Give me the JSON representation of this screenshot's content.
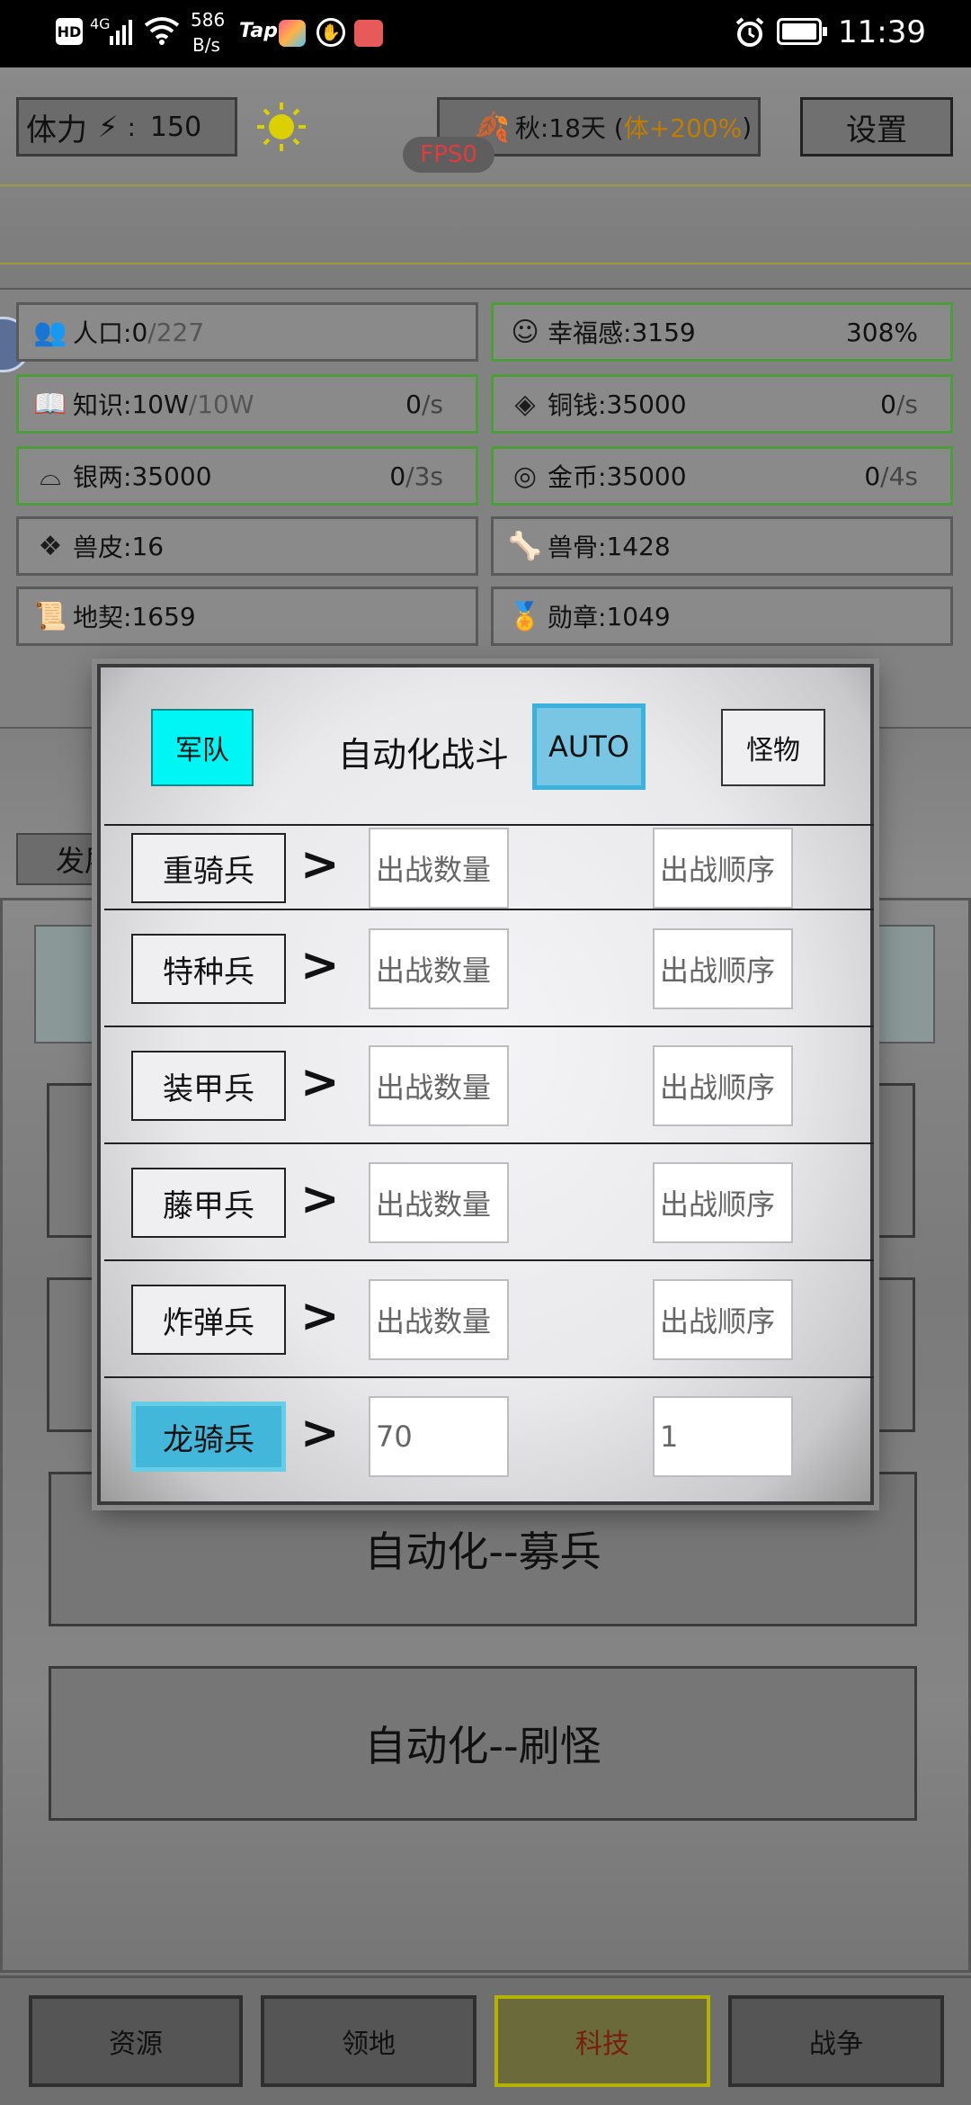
{
  "status_bar": {
    "hd": "HD",
    "network": "4G",
    "speed_value": "586",
    "speed_unit": "B/s",
    "tap": "Tap",
    "time": "11:39"
  },
  "hud": {
    "stamina_label": "体力",
    "stamina_sep": ":",
    "stamina_value": "150",
    "season_text": "秋:18天 (",
    "season_bonus": "体+200%",
    "season_close": ")",
    "settings_label": "设置",
    "fps": "FPS0"
  },
  "resources": [
    {
      "icon": "people-icon",
      "label": "人口:",
      "value": "0",
      "value_extra": "/227",
      "rate": "",
      "unit": "",
      "right": "",
      "highlight": false
    },
    {
      "icon": "smile-icon",
      "label": "幸福感:",
      "value": "3159",
      "value_extra": "",
      "rate": "",
      "unit": "",
      "right": "308%",
      "highlight": true
    },
    {
      "icon": "book-icon",
      "label": "知识:",
      "value": "10W",
      "value_extra": "/10W",
      "rate": "0",
      "unit": "/s",
      "right": "",
      "highlight": true
    },
    {
      "icon": "coin-icon",
      "label": "铜钱:",
      "value": "35000",
      "value_extra": "",
      "rate": "0",
      "unit": "/s",
      "right": "",
      "highlight": true
    },
    {
      "icon": "ingot-icon",
      "label": "银两:",
      "value": "35000",
      "value_extra": "",
      "rate": "0",
      "unit": "/3s",
      "right": "",
      "highlight": true
    },
    {
      "icon": "gold-coin-icon",
      "label": "金币:",
      "value": "35000",
      "value_extra": "",
      "rate": "0",
      "unit": "/4s",
      "right": "",
      "highlight": true
    },
    {
      "icon": "hide-icon",
      "label": "兽皮:",
      "value": "16",
      "value_extra": "",
      "rate": "",
      "unit": "",
      "right": "",
      "highlight": false
    },
    {
      "icon": "bone-icon",
      "label": "兽骨:",
      "value": "1428",
      "value_extra": "",
      "rate": "",
      "unit": "",
      "right": "",
      "highlight": false
    },
    {
      "icon": "deed-icon",
      "label": "地契:",
      "value": "1659",
      "value_extra": "",
      "rate": "",
      "unit": "",
      "right": "",
      "highlight": false
    },
    {
      "icon": "medal-icon",
      "label": "勋章:",
      "value": "1049",
      "value_extra": "",
      "rate": "",
      "unit": "",
      "right": "",
      "highlight": false
    }
  ],
  "bg_tab_partial": "发展",
  "modal": {
    "tab_army": "军队",
    "title": "自动化战斗",
    "auto": "AUTO",
    "tab_monster": "怪物",
    "arrow": ">",
    "rows": [
      {
        "unit": "重骑兵",
        "count": "",
        "order": "",
        "active": false
      },
      {
        "unit": "特种兵",
        "count": "",
        "order": "",
        "active": false
      },
      {
        "unit": "装甲兵",
        "count": "",
        "order": "",
        "active": false
      },
      {
        "unit": "藤甲兵",
        "count": "",
        "order": "",
        "active": false
      },
      {
        "unit": "炸弹兵",
        "count": "",
        "order": "",
        "active": false
      },
      {
        "unit": "龙骑兵",
        "count": "70",
        "order": "1",
        "active": true
      }
    ],
    "count_placeholder": "出战数量",
    "order_placeholder": "出战顺序"
  },
  "auto_buttons": {
    "recruit": "自动化--募兵",
    "monsters": "自动化--刷怪"
  },
  "nav": [
    "资源",
    "领地",
    "科技",
    "战争"
  ]
}
